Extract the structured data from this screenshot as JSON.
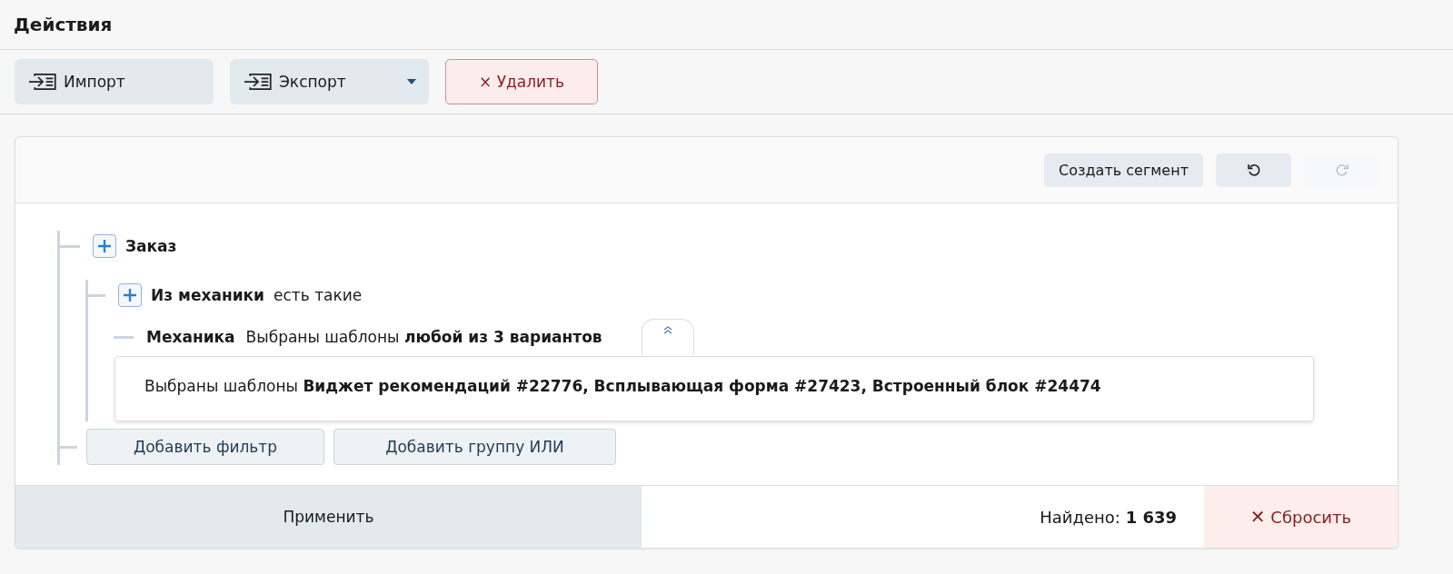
{
  "title": "Действия",
  "actions": [
    {
      "kind": "import",
      "label": "Импорт"
    },
    {
      "kind": "export",
      "label": "Экспорт"
    },
    {
      "kind": "delete",
      "glyph": "×",
      "label": "Удалить"
    }
  ],
  "segment_toolbar": {
    "create": "Создать сегмент",
    "undo_disabled": false,
    "redo_disabled": true
  },
  "tree": {
    "title": "Заказ",
    "children": [
      {
        "title": "Из механики",
        "note": "есть такие",
        "children": [
          {
            "title": "Механика",
            "note": "Выбраны шаблоны **любой из 3 вариантов**",
            "expanded": true,
            "detail": "Выбраны шаблоны **Виджет рекомендаций #22776, Всплывающая форма #27423, Встроенный блок #24474**"
          }
        ]
      }
    ]
  },
  "tree_buttons": [
    "Добавить фильтр",
    "Добавить группу ИЛИ"
  ],
  "footer": {
    "apply": "Применить",
    "found": "Найдено: **1 639**",
    "reset_glyph": "✕",
    "reset": "Сбросить"
  }
}
